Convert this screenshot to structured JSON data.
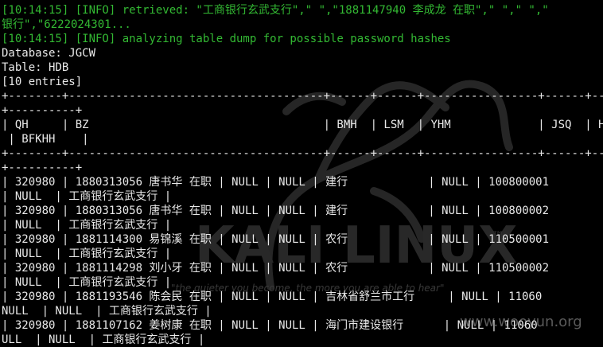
{
  "terminal": {
    "log_lines": [
      "[10:14:15] [INFO] retrieved: \"工商银行玄武支行\",\" \",\"1881147940 李成龙 在职\",\" \",\" \",\"",
      "银行\",\"6222024301...",
      "[10:14:15] [INFO] analyzing table dump for possible password hashes"
    ],
    "info_lines": [
      "Database: JGCW",
      "Table: HDB",
      "[10 entries]"
    ],
    "table_lines": [
      "+--------+--------------------------------------+------+------+-----------------+------+--------+-----------",
      "+----------+",
      "| QH     | BZ                                   | BMH  | LSM  | YHM             | JSQ  | HDH      | DWM",
      " | BFKHH    |",
      "+--------+--------------------------------------+------+------+-----------------+------+--------+-----------",
      "+----------+",
      "| 320980 | 1880313056 唐书华 在职 | NULL | NULL | 建行            | NULL | 100800001",
      "| NULL  | 工商银行玄武支行 |",
      "| 320980 | 1880313056 唐书华 在职 | NULL | NULL | 建行            | NULL | 100800002",
      "| NULL  | 工商银行玄武支行 |",
      "| 320980 | 1881114300 易锦溪 在职 | NULL | NULL | 农行            | NULL | 110500001",
      "| NULL  | 工商银行玄武支行 |",
      "| 320980 | 1881114298 刘小牙 在职 | NULL | NULL | 农行            | NULL | 110500002",
      "| NULL  | 工商银行玄武支行 |",
      "| 320980 | 1881193546 陈会民 在职 | NULL | NULL | 吉林省舒兰市工行     | NULL | 11060",
      "NULL  | NULL  | 工商银行玄武支行 |",
      "| 320980 | 1881107162 姜树康 在职 | NULL | NULL | 海门市建设银行      | NULL | 11060",
      "ULL  | NULL  | 工商银行玄武支行 |"
    ]
  },
  "watermark": {
    "brand_text": "KALI LINUX",
    "trademark": "™",
    "quote_text": "\"the quieter you become, the more you are able to hear\"",
    "site_text": "www.wooyun.org"
  },
  "colors": {
    "background": "#000000",
    "text": "#e9e9e9",
    "log_green": "#33b933",
    "watermark": "#3a3a3a"
  }
}
